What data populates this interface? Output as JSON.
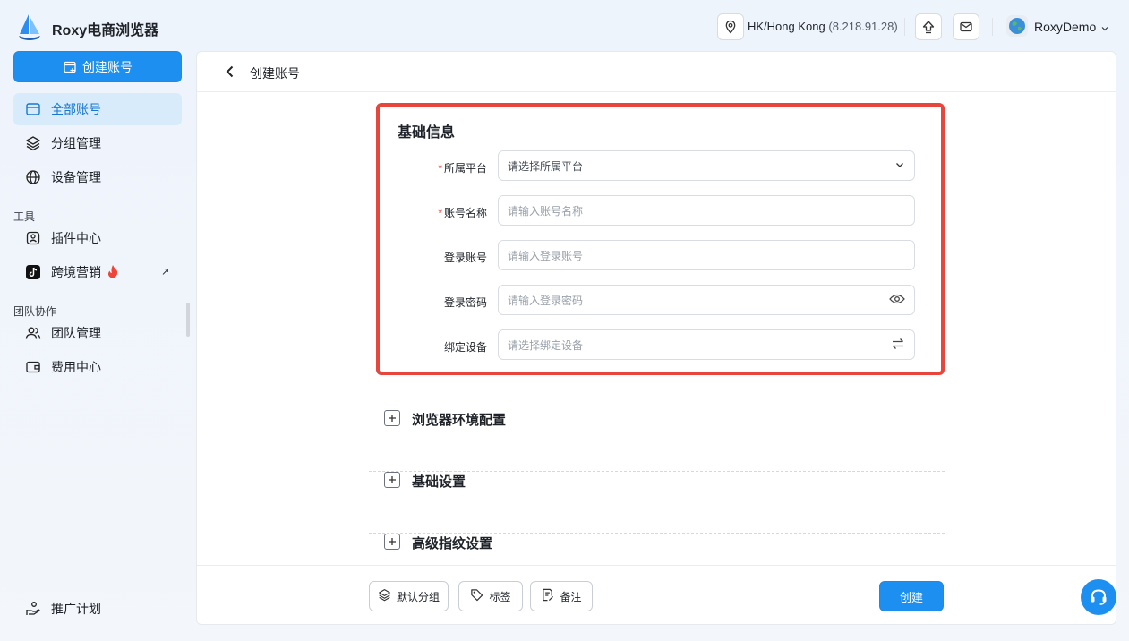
{
  "app": {
    "title": "Roxy电商浏览器"
  },
  "header": {
    "location": "HK/Hong Kong",
    "ip": "(8.218.91.28)",
    "user": "RoxyDemo"
  },
  "sidebar": {
    "create_label": "创建账号",
    "items": [
      {
        "label": "全部账号",
        "icon": "browser-window-icon",
        "active": true
      },
      {
        "label": "分组管理",
        "icon": "layers-icon"
      },
      {
        "label": "设备管理",
        "icon": "globe-icon"
      }
    ],
    "tools_label": "工具",
    "tools": [
      {
        "label": "插件中心",
        "icon": "plugin-icon"
      },
      {
        "label": "跨境营销",
        "icon": "tiktok-icon"
      }
    ],
    "team_label": "团队协作",
    "team": [
      {
        "label": "团队管理",
        "icon": "users-icon"
      },
      {
        "label": "费用中心",
        "icon": "wallet-icon"
      }
    ],
    "promo_label": "推广计划"
  },
  "main": {
    "title": "创建账号",
    "section_title": "基础信息",
    "fields": [
      {
        "label": "所属平台",
        "required": true,
        "placeholder": "请选择所属平台",
        "type": "select"
      },
      {
        "label": "账号名称",
        "required": true,
        "placeholder": "请输入账号名称",
        "type": "text"
      },
      {
        "label": "登录账号",
        "required": false,
        "placeholder": "请输入登录账号",
        "type": "text"
      },
      {
        "label": "登录密码",
        "required": false,
        "placeholder": "请输入登录密码",
        "type": "password"
      },
      {
        "label": "绑定设备",
        "required": false,
        "placeholder": "请选择绑定设备",
        "type": "device"
      }
    ],
    "collapsibles": [
      "浏览器环境配置",
      "基础设置",
      "高级指纹设置"
    ],
    "footer": {
      "default_group": "默认分组",
      "tags": "标签",
      "notes": "备注",
      "submit": "创建"
    }
  },
  "colors": {
    "accent": "#1c8ff0",
    "highlight": "#e8453c"
  }
}
